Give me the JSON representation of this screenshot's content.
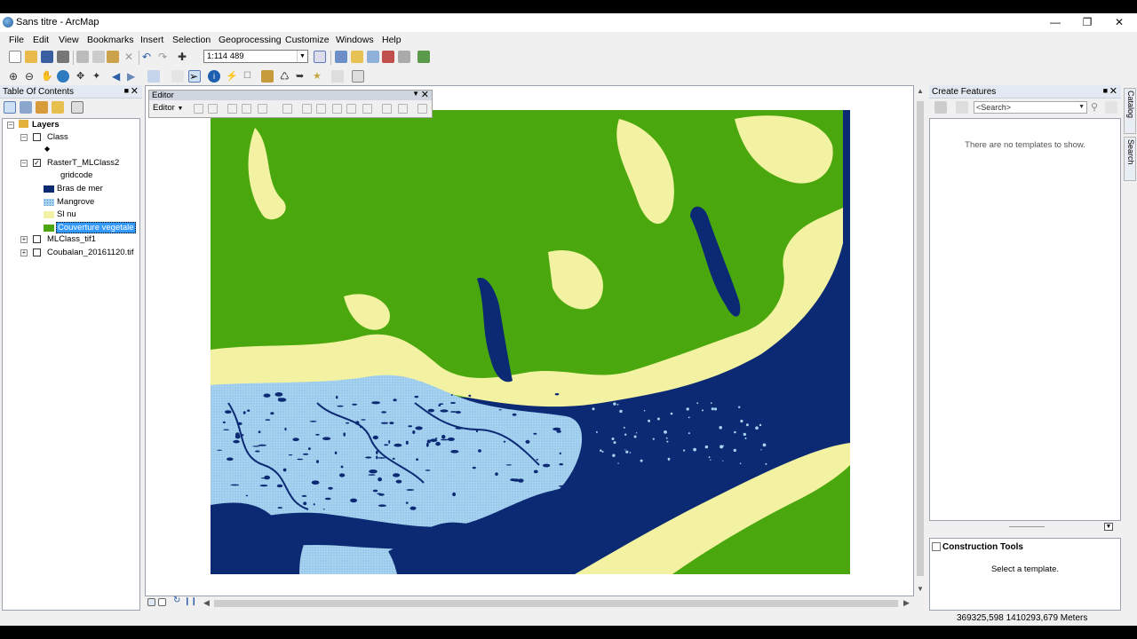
{
  "window": {
    "title": "Sans titre - ArcMap"
  },
  "menu": [
    "File",
    "Edit",
    "View",
    "Bookmarks",
    "Insert",
    "Selection",
    "Geoprocessing",
    "Customize",
    "Windows",
    "Help"
  ],
  "toolbar": {
    "scale": "1:114 489"
  },
  "toc": {
    "title": "Table Of Contents",
    "layers_label": "Layers",
    "items": [
      {
        "label": "Class",
        "checked": false
      },
      {
        "label": "RasterT_MLClass2",
        "checked": true
      },
      {
        "label": "MLClass_tif1",
        "checked": false
      },
      {
        "label": "Coubalan_20161120.tif",
        "checked": false
      }
    ],
    "field": "gridcode",
    "legend": [
      {
        "label": "Bras de mer",
        "color": "#0b2a73"
      },
      {
        "label": "Mangrove",
        "color": "#a6d3f0"
      },
      {
        "label": "Sl nu",
        "color": "#f2f2a2"
      },
      {
        "label": "Couverture vegetale",
        "color": "#4aa80e"
      }
    ]
  },
  "editor": {
    "title": "Editor",
    "menu_label": "Editor"
  },
  "create_features": {
    "title": "Create Features",
    "search_placeholder": "<Search>",
    "empty_text": "There are no templates to show."
  },
  "construction_tools": {
    "title": "Construction Tools",
    "message": "Select a template."
  },
  "side_tabs": [
    "Catalog",
    "Search"
  ],
  "status": {
    "coordinates": "369325,598  1410293,679 Meters"
  },
  "map_colors": {
    "sea": "#0b2a73",
    "mangrove": "#a6d3f0",
    "bare": "#f2f2a2",
    "vegetation": "#4aa80e"
  }
}
